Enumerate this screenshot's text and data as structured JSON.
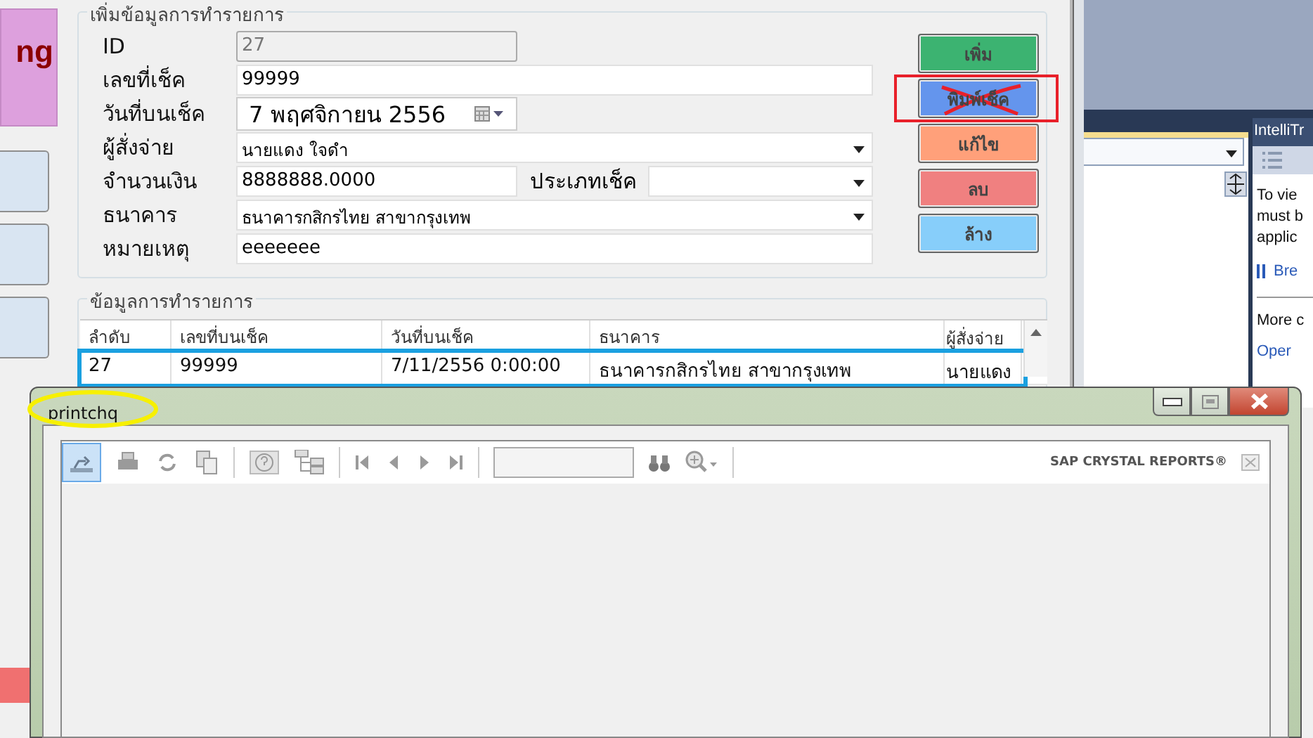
{
  "left_app": {
    "title_fragment": "ng"
  },
  "form_window": {
    "entry_group": {
      "title": "เพิ่มข้อมูลการทำรายการ",
      "fields": [
        {
          "label": "ID",
          "value": "27",
          "kind": "readonly"
        },
        {
          "label": "เลขที่เช็ค",
          "value": "99999",
          "kind": "text"
        },
        {
          "label": "วันที่บนเช็ค",
          "value": "7 พฤศจิกายน  2556",
          "kind": "date"
        },
        {
          "label": "ผู้สั่งจ่าย",
          "value": "นายแดง ใจดำ",
          "kind": "combo"
        },
        {
          "label": "จำนวนเงิน",
          "value": "8888888.0000",
          "kind": "text",
          "extra_label": "ประเภทเช็ค"
        },
        {
          "label": "ธนาคาร",
          "value": "ธนาคารกสิกรไทย สาขากรุงเทพ",
          "kind": "combo"
        },
        {
          "label": "หมายเหตุ",
          "value": "eeeeeee",
          "kind": "text"
        }
      ],
      "buttons": [
        {
          "label": "เพิ่ม",
          "color": "#3cb371",
          "marked": false
        },
        {
          "label": "พิมพ์เช็ค",
          "color": "#6495ed",
          "marked": true
        },
        {
          "label": "แก้ไข",
          "color": "#ffa07a",
          "marked": false
        },
        {
          "label": "ลบ",
          "color": "#f08080",
          "marked": false
        },
        {
          "label": "ล้าง",
          "color": "#87cefa",
          "marked": false
        }
      ]
    },
    "list_group": {
      "title": "ข้อมูลการทำรายการ",
      "columns": [
        "ลำดับ",
        "เลขที่บนเช็ค",
        "วันที่บนเช็ค",
        "ธนาคาร",
        "ผู้สั่งจ่าย"
      ],
      "rows": [
        {
          "cells": [
            "27",
            "99999",
            "7/11/2556 0:00:00",
            "ธนาคารกสิกรไทย สาขากรุงเทพ",
            "นายแดง"
          ],
          "marked": true
        }
      ]
    }
  },
  "ide_panel": {
    "title": "IntelliTr",
    "lines": [
      "To vie",
      "must b",
      "applic"
    ],
    "link": "Bre",
    "more": "More c",
    "open_link": "Oper"
  },
  "report_window": {
    "title": "printchq",
    "title_marked": true,
    "brand": "SAP CRYSTAL REPORTS®"
  }
}
